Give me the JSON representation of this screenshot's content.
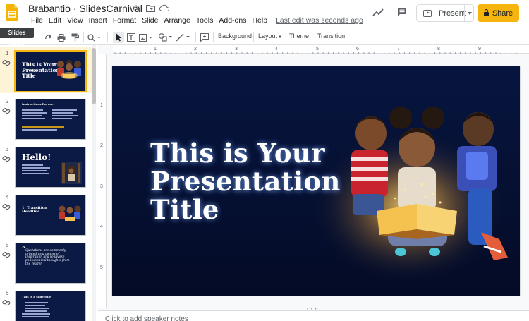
{
  "app": {
    "doc_title": "Brabantio · SlidesCarnival",
    "tooltip": "Slides home",
    "last_edit": "Last edit was seconds ago"
  },
  "menu": [
    "File",
    "Edit",
    "View",
    "Insert",
    "Format",
    "Slide",
    "Arrange",
    "Tools",
    "Add-ons",
    "Help"
  ],
  "header_buttons": {
    "present_label": "Present",
    "share_label": "Share"
  },
  "toolbar": {
    "background_label": "Background",
    "layout_label": "Layout",
    "theme_label": "Theme",
    "transition_label": "Transition"
  },
  "ruler": {
    "h_ticks": [
      "1",
      "2",
      "3",
      "4",
      "5",
      "6",
      "7",
      "8",
      "9"
    ],
    "v_ticks": [
      "1",
      "2",
      "3",
      "4",
      "5"
    ]
  },
  "slides": [
    {
      "num": "1",
      "title": "This is Your Presentation Title"
    },
    {
      "num": "2",
      "title": "Instructions for use"
    },
    {
      "num": "3",
      "title": "Hello!"
    },
    {
      "num": "4",
      "title": "1. Transition Headline"
    },
    {
      "num": "5",
      "title": "Quotations are commonly printed as a means of inspiration and to invoke philosophical thoughts from the reader."
    },
    {
      "num": "6",
      "title": "This is a slide title"
    }
  ],
  "main_slide": {
    "title": "This is Your\nPresentation\nTitle"
  },
  "notes_placeholder": "Click to add speaker notes",
  "colors": {
    "share": "#f6b40e",
    "slide_bg": "#061235",
    "active_thumb_bg": "#fdf3d6"
  }
}
